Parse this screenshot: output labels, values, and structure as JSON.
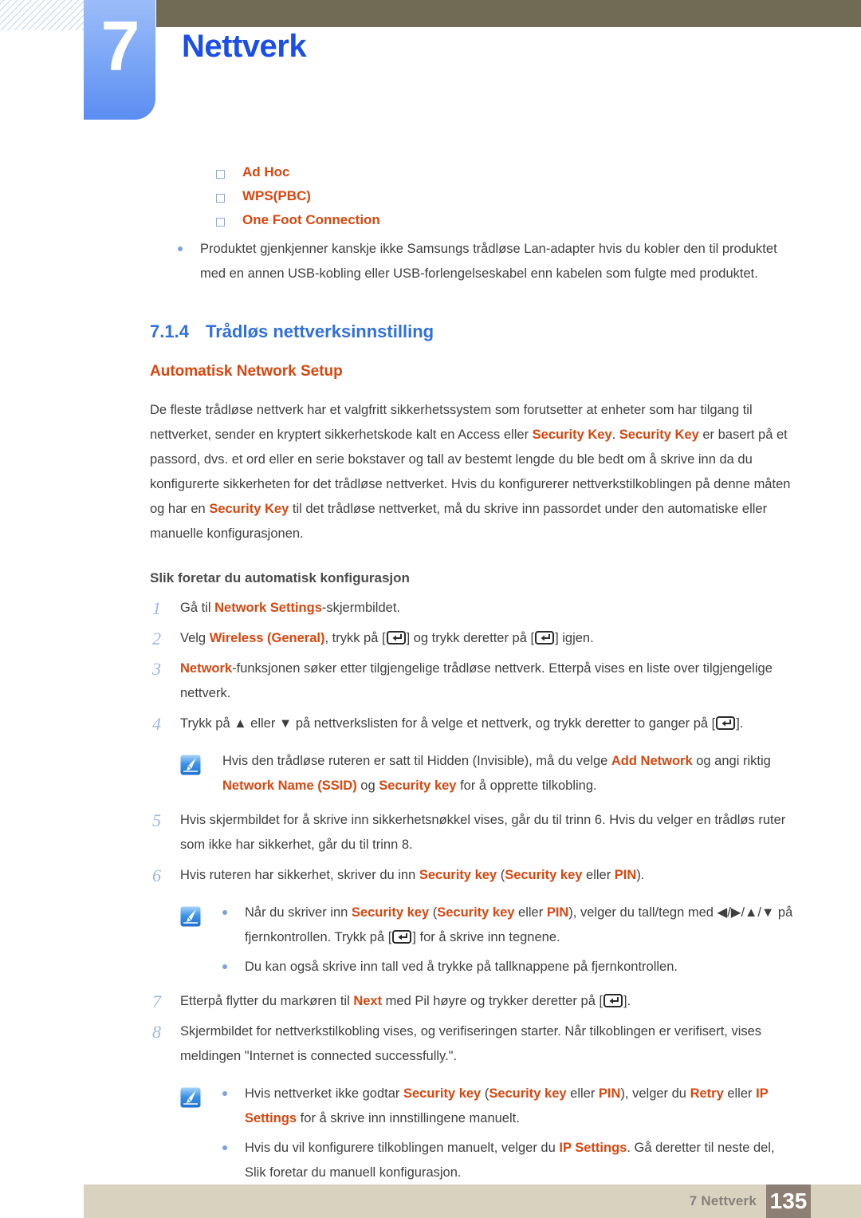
{
  "chapter": {
    "number": "7",
    "title": "Nettverk"
  },
  "colors": {
    "accent_blue": "#1b4ee8",
    "heading_blue": "#2f6fe0",
    "highlight_orange": "#d9460f",
    "olive_bar": "#6f6b54",
    "footer_beige": "#d8d2be",
    "footer_page_box": "#8d7f74",
    "step_number": "#9fb6e3"
  },
  "top_list": {
    "items": [
      {
        "label": "Ad Hoc"
      },
      {
        "label": "WPS(PBC)"
      },
      {
        "label": "One Foot Connection"
      }
    ],
    "note_bullet": "Produktet gjenkjenner kanskje ikke Samsungs trådløse Lan-adapter hvis du kobler den til produktet med en annen USB-kobling eller USB-forlengelseskabel enn kabelen som fulgte med produktet."
  },
  "section": {
    "number": "7.1.4",
    "title": "Trådløs nettverksinnstilling",
    "sub_heading": "Automatisk Network Setup",
    "intro": {
      "p1": "De fleste trådløse nettverk har et valgfritt sikkerhetssystem som forutsetter at enheter som har tilgang til nettverket, sender en kryptert sikkerhetskode kalt en Access eller ",
      "hl1": "Security Key",
      "p2": ". ",
      "hl2": "Security Key",
      "p3": " er basert på et passord, dvs. et ord eller en serie bokstaver og tall av bestemt lengde du ble bedt om å skrive inn da du konfigurerte sikkerheten for det trådløse nettverket. Hvis du konfigurerer nettverkstilkoblingen på denne måten og har en ",
      "hl3": "Security Key",
      "p4": " til det trådløse nettverket, må du skrive inn passordet under den automatiske eller manuelle konfigurasjonen."
    },
    "procedure_heading": "Slik foretar du automatisk konfigurasjon"
  },
  "steps": [
    {
      "num": "1",
      "parts": [
        {
          "t": "Gå til ",
          "hl": false
        },
        {
          "t": "Network Settings",
          "hl": true
        },
        {
          "t": "-skjermbildet.",
          "hl": false
        }
      ]
    },
    {
      "num": "2",
      "parts": [
        {
          "t": "Velg ",
          "hl": false
        },
        {
          "t": "Wireless (General)",
          "hl": true
        },
        {
          "t": ", trykk på [",
          "hl": false
        },
        {
          "t": "__ENTER__",
          "hl": false
        },
        {
          "t": "] og trykk deretter på [",
          "hl": false
        },
        {
          "t": "__ENTER__",
          "hl": false
        },
        {
          "t": "] igjen.",
          "hl": false
        }
      ]
    },
    {
      "num": "3",
      "parts": [
        {
          "t": "Network",
          "hl": true
        },
        {
          "t": "-funksjonen søker etter tilgjengelige trådløse nettverk. Etterpå vises en liste over tilgjengelige nettverk.",
          "hl": false
        }
      ]
    },
    {
      "num": "4",
      "parts": [
        {
          "t": "Trykk på ▲ eller ▼ på nettverkslisten for å velge et nettverk, og trykk deretter to ganger på [",
          "hl": false
        },
        {
          "t": "__ENTER__",
          "hl": false
        },
        {
          "t": "].",
          "hl": false
        }
      ]
    },
    {
      "num": "5",
      "parts": [
        {
          "t": "Hvis skjermbildet for å skrive inn sikkerhetsnøkkel vises, går du til trinn 6. Hvis du velger en trådløs ruter som ikke har sikkerhet, går du til trinn 8.",
          "hl": false
        }
      ]
    },
    {
      "num": "6",
      "parts": [
        {
          "t": "Hvis ruteren har sikkerhet, skriver du inn ",
          "hl": false
        },
        {
          "t": "Security key",
          "hl": true
        },
        {
          "t": " (",
          "hl": false
        },
        {
          "t": "Security key",
          "hl": true
        },
        {
          "t": " eller ",
          "hl": false
        },
        {
          "t": "PIN",
          "hl": true
        },
        {
          "t": ").",
          "hl": false
        }
      ]
    },
    {
      "num": "7",
      "parts": [
        {
          "t": "Etterpå flytter du markøren til ",
          "hl": false
        },
        {
          "t": "Next",
          "hl": true
        },
        {
          "t": " med Pil høyre og trykker deretter på [",
          "hl": false
        },
        {
          "t": "__ENTER__",
          "hl": false
        },
        {
          "t": "].",
          "hl": false
        }
      ]
    },
    {
      "num": "8",
      "parts": [
        {
          "t": "Skjermbildet for nettverkstilkobling vises, og verifiseringen starter. Når tilkoblingen er verifisert, vises meldingen \"Internet is connected successfully.\".",
          "hl": false
        }
      ]
    }
  ],
  "notes": {
    "note1": {
      "icon": "note-pencil-icon",
      "lines": [
        [
          {
            "t": "Hvis den trådløse ruteren er satt til Hidden (Invisible), må du velge ",
            "hl": false
          },
          {
            "t": "Add Network",
            "hl": true
          },
          {
            "t": " og angi riktig ",
            "hl": false
          },
          {
            "t": "Network Name (SSID)",
            "hl": true
          },
          {
            "t": " og ",
            "hl": false
          },
          {
            "t": "Security key",
            "hl": true
          },
          {
            "t": " for å opprette tilkobling.",
            "hl": false
          }
        ]
      ]
    },
    "note2": {
      "icon": "note-pencil-icon",
      "bullets": [
        [
          {
            "t": "Når du skriver inn ",
            "hl": false
          },
          {
            "t": "Security key",
            "hl": true
          },
          {
            "t": " (",
            "hl": false
          },
          {
            "t": "Security key",
            "hl": true
          },
          {
            "t": " eller ",
            "hl": false
          },
          {
            "t": "PIN",
            "hl": true
          },
          {
            "t": "), velger du tall/tegn med ◀/▶/▲/▼ på fjernkontrollen. Trykk på [",
            "hl": false
          },
          {
            "t": "__ENTER__",
            "hl": false
          },
          {
            "t": "] for å skrive inn tegnene.",
            "hl": false
          }
        ],
        [
          {
            "t": "Du kan også skrive inn tall ved å trykke på tallknappene på fjernkontrollen.",
            "hl": false
          }
        ]
      ]
    },
    "note3": {
      "icon": "note-pencil-icon",
      "bullets": [
        [
          {
            "t": "Hvis nettverket ikke godtar ",
            "hl": false
          },
          {
            "t": "Security key",
            "hl": true
          },
          {
            "t": " (",
            "hl": false
          },
          {
            "t": "Security key",
            "hl": true
          },
          {
            "t": " eller ",
            "hl": false
          },
          {
            "t": "PIN",
            "hl": true
          },
          {
            "t": "), velger du ",
            "hl": false
          },
          {
            "t": "Retry",
            "hl": true
          },
          {
            "t": " eller ",
            "hl": false
          },
          {
            "t": "IP Settings",
            "hl": true
          },
          {
            "t": " for å skrive inn innstillingene manuelt.",
            "hl": false
          }
        ],
        [
          {
            "t": "Hvis du vil konfigurere tilkoblingen manuelt, velger du ",
            "hl": false
          },
          {
            "t": "IP Settings",
            "hl": true
          },
          {
            "t": ". Gå deretter til neste del, Slik foretar du manuell konfigurasjon.",
            "hl": false
          }
        ]
      ]
    }
  },
  "footer": {
    "label": "7 Nettverk",
    "page_number": "135"
  }
}
